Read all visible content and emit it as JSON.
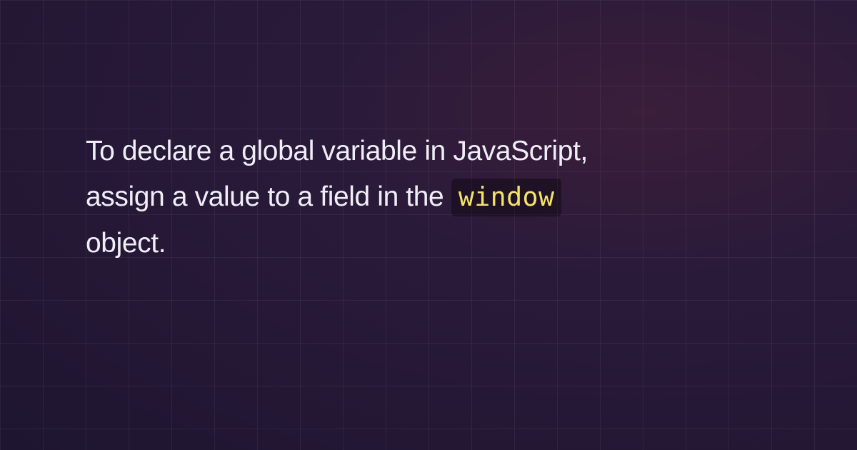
{
  "description": {
    "text_before_code": "To declare a global variable in JavaScript, assign a value to a field in the ",
    "code": "window",
    "text_after_code": " object."
  },
  "colors": {
    "code_text": "#f5e26a",
    "code_bg": "rgba(0,0,0,0.35)",
    "body_text": "#efeef6"
  }
}
